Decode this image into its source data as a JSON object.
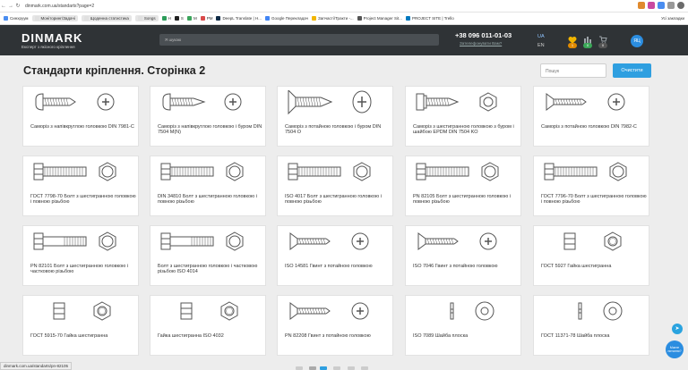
{
  "browser": {
    "url": "dinmark.com.ua/standarts?page=2",
    "bookmarks": [
      {
        "label": "Синхруум",
        "color": "#4a8df0",
        "pill": false
      },
      {
        "label": "Моніторинг/Задачі",
        "color": "#e0e0e0",
        "pill": true
      },
      {
        "label": "Щоденна статистика",
        "color": "#e0e0e0",
        "pill": true
      },
      {
        "label": "Songs",
        "color": "#e0e0e0",
        "pill": true
      },
      {
        "label": "Н",
        "color": "#2d9c5a",
        "pill": false
      },
      {
        "label": "S",
        "color": "#222",
        "pill": false
      },
      {
        "label": "M",
        "color": "#3ba55c",
        "pill": false
      },
      {
        "label": "PM",
        "color": "#d94a4a",
        "pill": false
      },
      {
        "label": "DeepL Translate | Н...",
        "color": "#0f2b46",
        "pill": false
      },
      {
        "label": "Google Перекладач",
        "color": "#4285f4",
        "pill": false
      },
      {
        "label": "Запчасті/Тракти -...",
        "color": "#f2b600",
        "pill": false
      },
      {
        "label": "Project Manager Sit...",
        "color": "#555",
        "pill": false
      },
      {
        "label": "PROJECT SITE | Trello",
        "color": "#0079bf",
        "pill": false
      }
    ],
    "bookmarks_tail": "Усі закладки",
    "status_url": "dinmark.com.ua/standarts/pn-82105"
  },
  "header": {
    "logo": "DINMARK",
    "tagline": "Експерт з якісного кріплення",
    "search_placeholder": "Я шукаю",
    "phone": "+38 096 011-01-03",
    "callback": "Зателефонувати Вам?",
    "lang_active": "UA",
    "lang_other": "EN",
    "badges": [
      "1",
      "0",
      "0"
    ],
    "avatar": "ЯЦ"
  },
  "page": {
    "title": "Стандарти кріплення. Сторінка 2",
    "filter_placeholder": "Пошук",
    "clear_button": "Очистити"
  },
  "cards": [
    {
      "label": "Саморіз з напівкруглою головкою DIN 7981-C",
      "icon": "pan-screw"
    },
    {
      "label": "Саморіз з напівкруглою головкою і буром DIN 7504 M(N)",
      "icon": "pan-drill-screw"
    },
    {
      "label": "Саморіз з потайною головкою і буром DIN 7504 O",
      "icon": "csk-drill-screw"
    },
    {
      "label": "Саморіз з шестигранною головкою з буром і шайбою EPDM DIN 7504 KO",
      "icon": "hex-drill-screw"
    },
    {
      "label": "Саморіз з потайною головкою DIN 7982-C",
      "icon": "csk-screw"
    },
    {
      "label": "ГОСТ 7798-70 Болт з шестигранною головкою і повною різьбою",
      "icon": "hex-bolt"
    },
    {
      "label": "DIN 34810 Болт з шестигранною головкою і повною різьбою",
      "icon": "hex-bolt"
    },
    {
      "label": "ISO 4017 Болт з шестигранною головкою і повною різьбою",
      "icon": "hex-bolt"
    },
    {
      "label": "PN 82105 Болт з шестигранною головкою і повною різьбою",
      "icon": "hex-bolt"
    },
    {
      "label": "ГОСТ 7796-70 Болт з шестигранною головкою і повною різьбою",
      "icon": "hex-bolt"
    },
    {
      "label": "PN 82101 Болт з шестигранною головкою і частковою різьбою",
      "icon": "hex-bolt-partial"
    },
    {
      "label": "Болт з шестигранною головкою і частковою різьбою ISO 4014",
      "icon": "hex-bolt-partial"
    },
    {
      "label": "ISO 14581 Гвинт з потайною головкою",
      "icon": "csk-screw"
    },
    {
      "label": "ISO 7046 Гвинт з потайною головкою",
      "icon": "csk-screw"
    },
    {
      "label": "ГОСТ 5927 Гайка шестигранна",
      "icon": "hex-nut"
    },
    {
      "label": "ГОСТ 5915-70 Гайка шестигранна",
      "icon": "hex-nut"
    },
    {
      "label": "Гайка шестигранна ISO 4032",
      "icon": "hex-nut"
    },
    {
      "label": "PN 82208 Гвинт з потайною головкою",
      "icon": "csk-screw"
    },
    {
      "label": "ISO 7089 Шайба плоска",
      "icon": "washer"
    },
    {
      "label": "ГОСТ 11371-78 Шайба плоска",
      "icon": "washer"
    }
  ],
  "widgets": {
    "telegram_icon": "telegram-icon",
    "help_text": "Маєте питання?"
  },
  "colors": {
    "accent": "#2f9fe0",
    "header_bg": "#2f3336"
  }
}
